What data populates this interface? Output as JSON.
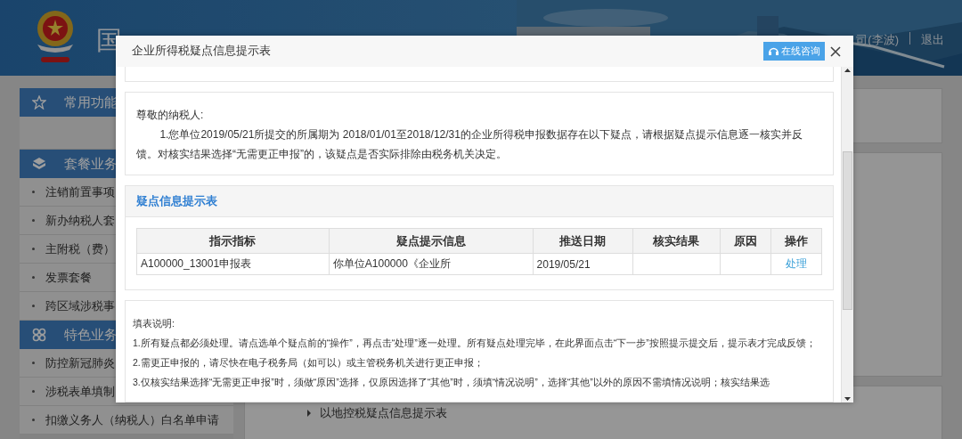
{
  "header": {
    "title": "国",
    "user": "司(李波)",
    "logout": "退出"
  },
  "sidebar": {
    "sections": [
      {
        "title": "常用功能",
        "kind": "star"
      },
      {
        "title": "套餐业务",
        "kind": "cube",
        "items": [
          "注销前置事项",
          "新办纳税人套",
          "主附税（费）",
          "发票套餐",
          "跨区域涉税事"
        ]
      },
      {
        "title": "特色业务",
        "kind": "circles",
        "items": [
          "防控新冠肺炎",
          "涉税表单填制",
          "扣缴义务人（纳税人）白名单申请"
        ]
      }
    ]
  },
  "content": {
    "link": "以地控税疑点信息提示表"
  },
  "dialog": {
    "title": "企业所得税疑点信息提示表",
    "consult_button": "在线咨询",
    "greeting": "尊敬的纳税人:",
    "notice": "1.您单位2019/05/21所提交的所属期为 2018/01/01至2018/12/31的企业所得税申报数据存在以下疑点，请根据疑点提示信息逐一核实并反馈。对核实结果选择“无需更正申报”的，该疑点是否实际排除由税务机关决定。",
    "section_title": "疑点信息提示表",
    "table": {
      "columns": [
        "指示指标",
        "疑点提示信息",
        "推送日期",
        "核实结果",
        "原因",
        "操作"
      ],
      "rows": [
        {
          "cells": [
            "A100000_13001申报表",
            "你单位A100000《企业所",
            "2019/05/21",
            "",
            ""
          ],
          "action": "处理"
        }
      ]
    },
    "instructions_title": "填表说明:",
    "instructions": [
      "1.所有疑点都必须处理。请点选单个疑点前的“操作”，再点击“处理”逐一处理。所有疑点处理完毕，在此界面点击“下一步”按照提示提交后，提示表才完成反馈；",
      "2.需更正申报的，请尽快在电子税务局（如可以）或主管税务机关进行更正申报；",
      "3.仅核实结果选择“无需更正申报”时，须做“原因”选择，仅原因选择了“其他”时，须填“情况说明”，选择“其他”以外的原因不需填情况说明；核实结果选"
    ]
  }
}
